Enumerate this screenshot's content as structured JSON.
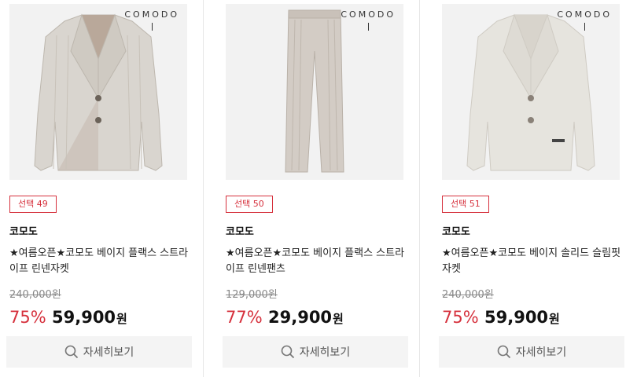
{
  "products": [
    {
      "image_brand_mark": "COMODO",
      "badge": "선택 49",
      "brand": "코모도",
      "title": "★여름오픈★코모도 베이지 플랙스 스트라이프 린넨자켓",
      "original_price": "240,000원",
      "discount": "75%",
      "price": "59,900",
      "currency": "원",
      "detail_label": "자세히보기",
      "image_color": "#d9d5cf"
    },
    {
      "image_brand_mark": "COMODO",
      "badge": "선택 50",
      "brand": "코모도",
      "title": "★여름오픈★코모도 베이지 플랙스 스트라이프 린넨팬츠",
      "original_price": "129,000원",
      "discount": "77%",
      "price": "29,900",
      "currency": "원",
      "detail_label": "자세히보기",
      "image_color": "#d3ccc5"
    },
    {
      "image_brand_mark": "COMODO",
      "badge": "선택 51",
      "brand": "코모도",
      "title": "★여름오픈★코모도 베이지 솔리드 슬림핏 자켓",
      "original_price": "240,000원",
      "discount": "75%",
      "price": "59,900",
      "currency": "원",
      "detail_label": "자세히보기",
      "image_color": "#e4e2dc"
    }
  ],
  "colors": {
    "accent_red": "#d6313d",
    "button_bg": "#f4f4f4"
  }
}
